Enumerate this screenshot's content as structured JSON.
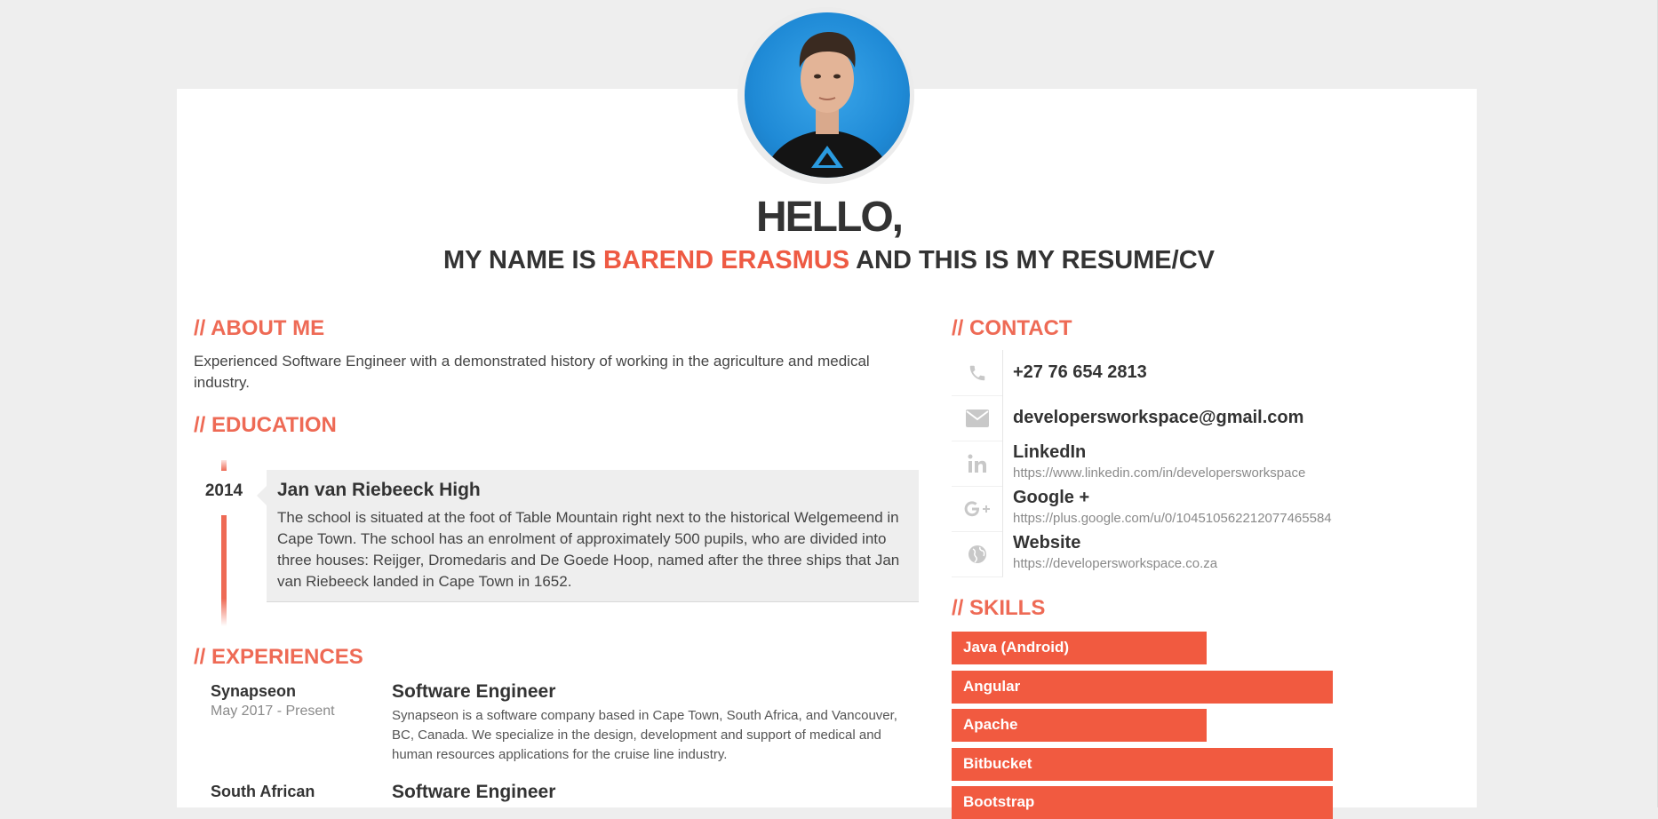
{
  "header": {
    "hello": "HELLO,",
    "subtitle_prefix": "MY NAME IS",
    "name": "BAREND ERASMUS",
    "subtitle_suffix": "AND THIS IS MY RESUME/CV"
  },
  "about": {
    "title": "// ABOUT ME",
    "text": "Experienced Software Engineer with a demonstrated history of working in the agriculture and medical industry."
  },
  "education": {
    "title": "// EDUCATION",
    "items": [
      {
        "year": "2014",
        "school": "Jan van Riebeeck High",
        "description": "The school is situated at the foot of Table Mountain right next to the historical Welgemeend in Cape Town. The school has an enrolment of approximately 500 pupils, who are divided into three houses: Reijger, Dromedaris and De Goede Hoop, named after the three ships that Jan van Riebeeck landed in Cape Town in 1652."
      }
    ]
  },
  "experiences": {
    "title": "// EXPERIENCES",
    "items": [
      {
        "company": "Synapseon",
        "date": "May 2017 - Present",
        "role": "Software Engineer",
        "description": "Synapseon is a software company based in Cape Town, South Africa, and Vancouver, BC, Canada. We specialize in the design, development and support of medical and human resources applications for the cruise line industry."
      },
      {
        "company": "South African",
        "role": "Software Engineer"
      }
    ]
  },
  "contact": {
    "title": "// CONTACT",
    "items": [
      {
        "icon": "phone-icon",
        "main": "+27 76 654 2813"
      },
      {
        "icon": "envelope-icon",
        "main": "developersworkspace@gmail.com"
      },
      {
        "icon": "linkedin-icon",
        "main": "LinkedIn",
        "sub": "https://www.linkedin.com/in/developersworkspace"
      },
      {
        "icon": "google-plus-icon",
        "main": "Google +",
        "sub": "https://plus.google.com/u/0/104510562212077465584"
      },
      {
        "icon": "globe-icon",
        "main": "Website",
        "sub": "https://developersworkspace.co.za"
      }
    ]
  },
  "skills": {
    "title": "// SKILLS",
    "items": [
      {
        "name": "Java (Android)",
        "level": 0.67
      },
      {
        "name": "Angular",
        "level": 1.0
      },
      {
        "name": "Apache",
        "level": 0.67
      },
      {
        "name": "Bitbucket",
        "level": 1.0
      },
      {
        "name": "Bootstrap",
        "level": 1.0
      }
    ]
  },
  "colors": {
    "accent": "#ee5a43",
    "section_title": "#ee6a55",
    "skill_bar": "#f15a40",
    "page_background": "#eeeeee"
  }
}
